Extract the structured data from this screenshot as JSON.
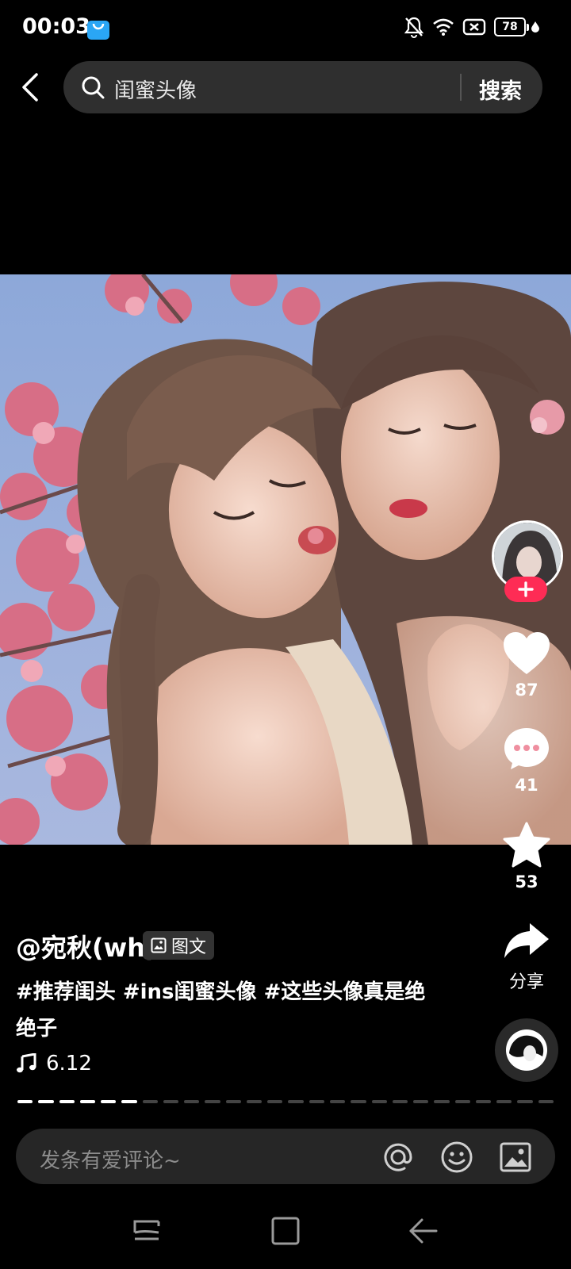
{
  "status_bar": {
    "time": "00:03",
    "battery": "78"
  },
  "search": {
    "query": "闺蜜头像",
    "button_label": "搜索"
  },
  "post": {
    "author": "@宛秋(wh)",
    "type_chip": "图文",
    "description": "#推荐闺头 #ins闺蜜头像 #这些头像真是绝绝子",
    "music": "6.12"
  },
  "actions": {
    "likes": "87",
    "comments": "41",
    "favorites": "53",
    "share_label": "分享"
  },
  "progress": {
    "current_page": 6,
    "total_pages": 26
  },
  "comment": {
    "placeholder": "发条有爱评论~"
  },
  "colors": {
    "accent": "#fe2c55",
    "background": "#000000"
  }
}
